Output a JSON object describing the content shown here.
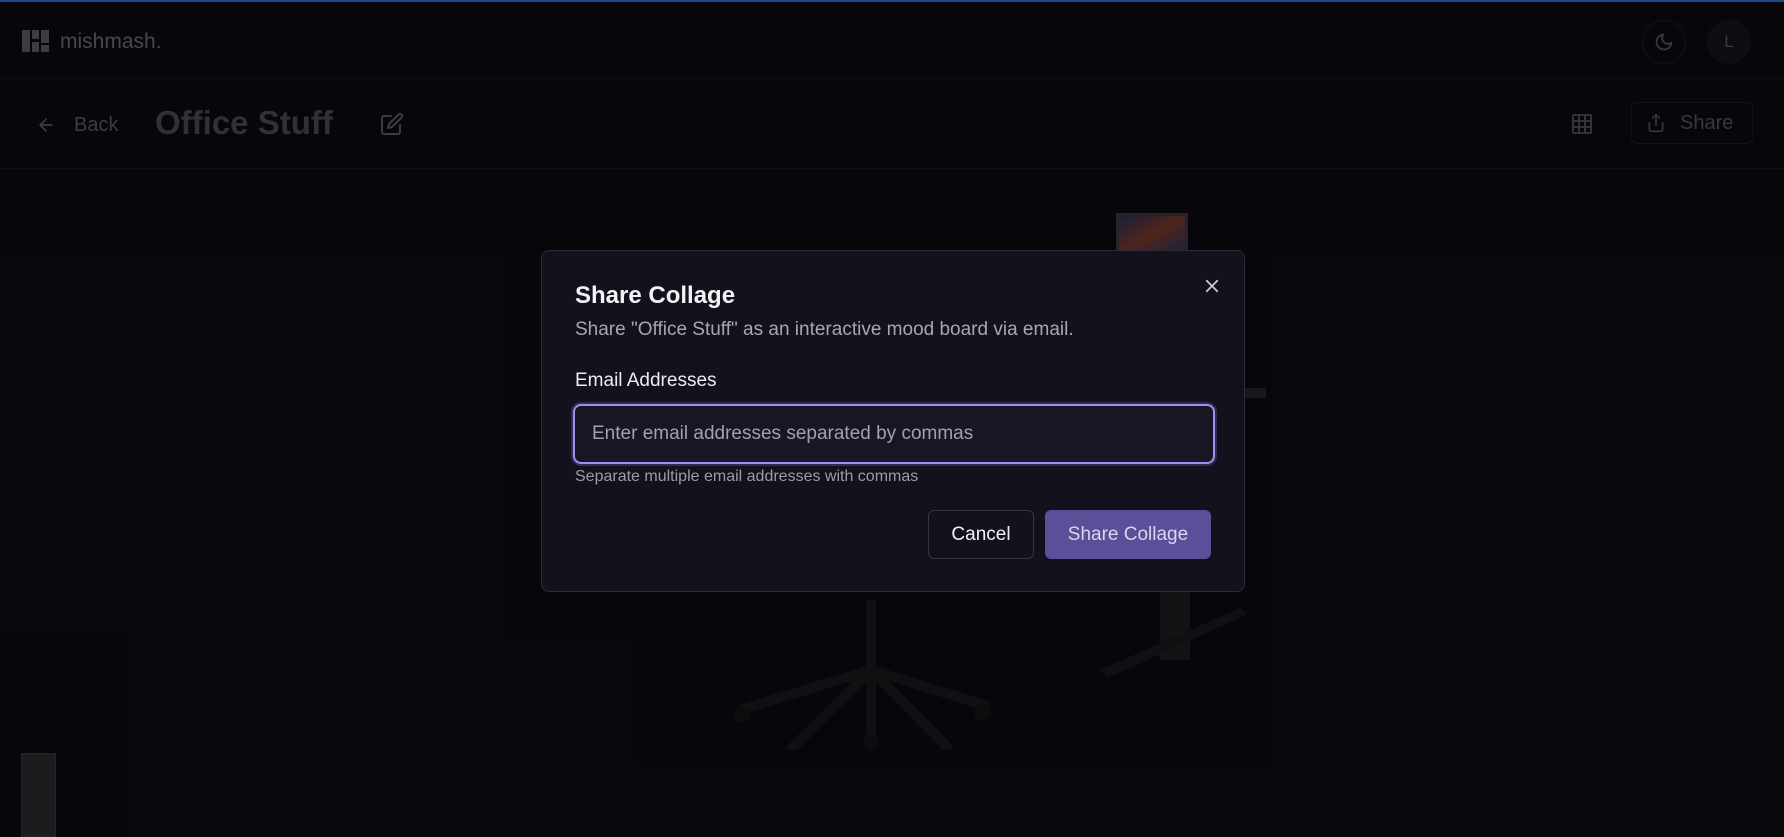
{
  "app": {
    "name": "mishmash.",
    "avatar_initial": "L"
  },
  "toolbar": {
    "back_label": "Back",
    "title": "Office Stuff",
    "share_label": "Share"
  },
  "dialog": {
    "title": "Share Collage",
    "description": "Share \"Office Stuff\" as an interactive mood board via email.",
    "field_label": "Email Addresses",
    "input_value": "",
    "input_placeholder": "Enter email addresses separated by commas",
    "help_text": "Separate multiple email addresses with commas",
    "cancel_label": "Cancel",
    "submit_label": "Share Collage"
  },
  "icons": {
    "logo": "grid-logo-icon",
    "theme": "moon-icon",
    "back": "arrow-left-icon",
    "edit": "pencil-square-icon",
    "layout": "grid-icon",
    "share": "upload-icon",
    "close": "close-icon"
  },
  "colors": {
    "accent": "#a08df0",
    "submit_bg": "#5a4f98",
    "top_stripe": "#2f6fe0",
    "background": "#0b0b12",
    "dialog_bg": "#12121d"
  }
}
